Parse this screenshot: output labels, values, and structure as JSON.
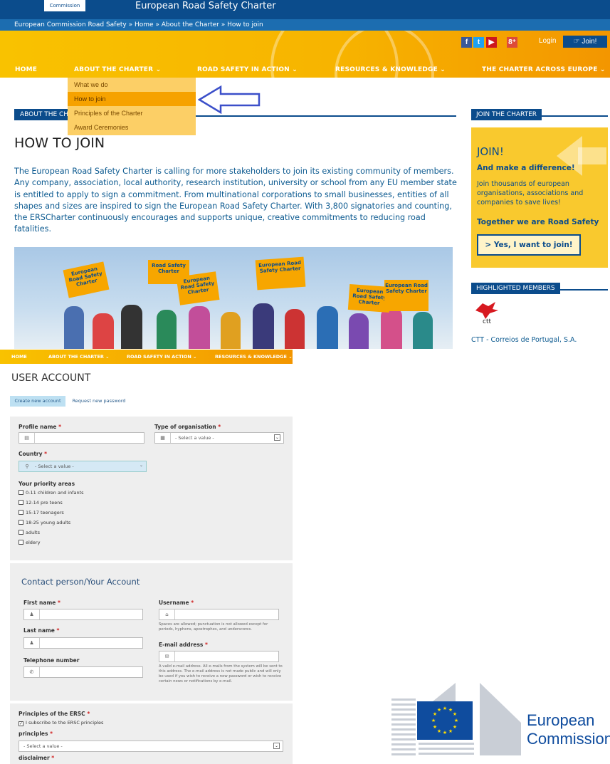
{
  "site": {
    "commission_logo": "Commission",
    "title": "European Road Safety Charter",
    "breadcrumb": "European Commission Road Safety » Home » About the Charter » How to join",
    "login": "Login",
    "join_button": "Join!",
    "social_icons": [
      "facebook-icon",
      "twitter-icon",
      "youtube-icon",
      "googleplus-icon"
    ]
  },
  "nav": {
    "home": "HOME",
    "about": "ABOUT THE CHARTER ⌄",
    "action": "ROAD SAFETY IN ACTION ⌄",
    "resources": "RESOURCES & KNOWLEDGE ⌄",
    "across": "THE CHARTER ACROSS EUROPE ⌄"
  },
  "dropdown": {
    "items": [
      "What we do",
      "How to join",
      "Principles of the Charter",
      "Award Ceremonies"
    ],
    "active_index": 1
  },
  "section_head": "ABOUT THE CHARTER",
  "page_title": "HOW TO JOIN",
  "intro": "The European Road Safety Charter is calling for more stakeholders to join its existing community of members. Any company, association, local authority, research institution, university or school from any EU member state is entitled to apply to sign a commitment. From multinational corporations to small businesses, entities of all shapes and sizes are inspired to sign the European Road Safety Charter. With 3,800 signatories and counting, the ERSCharter continuously encourages and supports unique, creative commitments to reducing road fatalities.",
  "photo_signs": [
    "European Road Safety Charter",
    "Road Safety Charter",
    "European Road Safety Charter",
    "European Road Safety Charter",
    "European Road Safety Charter",
    "European Road Safety Charter"
  ],
  "sidebar": {
    "join_head": "JOIN THE CHARTER",
    "join_title": "JOIN!",
    "join_sub": "And make a difference!",
    "join_text": "Join thousands of european organisations, associations and companies to save lives!",
    "join_together": "Together we are Road Safety",
    "join_yes": "> Yes, I want to join!",
    "highlighted_head": "HIGHLIGHTED MEMBERS",
    "member_logo_text": "ctt",
    "member_name": "CTT - Correios de Portugal, S.A."
  },
  "form": {
    "mini_nav": [
      "HOME",
      "ABOUT THE CHARTER ⌄",
      "ROAD SAFETY IN ACTION ⌄",
      "RESOURCES & KNOWLEDGE ⌄"
    ],
    "title": "USER ACCOUNT",
    "tabs": [
      "Create new account",
      "Request new password"
    ],
    "profile_name": "Profile name",
    "org_type": "Type of organisation",
    "org_type_value": "- Select a value -",
    "country": "Country",
    "country_value": "- Select a value -",
    "priority_areas": "Your priority areas",
    "priorities": [
      "0-11 children and infants",
      "12-14 pre teens",
      "15-17 teenagers",
      "18-25 young adults",
      "adults",
      "eldery"
    ],
    "contact_title": "Contact person/Your Account",
    "first_name": "First name",
    "last_name": "Last name",
    "telephone": "Telephone number",
    "username": "Username",
    "username_help": "Spaces are allowed; punctuation is not allowed except for periods, hyphens, apostrophes, and underscores.",
    "email": "E-mail address",
    "email_help": "A valid e-mail address. All e-mails from the system will be sent to this address. The e-mail address is not made public and will only be used if you wish to receive a new password or wish to receive certain news or notifications by e-mail.",
    "principles_head": "Principles of the ERSC",
    "subscribe": "I subscribe to the ERSC principles",
    "principles": "principles",
    "principles_value": "- Select a value -",
    "disclaimer": "disclaimer",
    "required_mark": "*"
  },
  "eu_logo": {
    "line1": "European",
    "line2": "Commission"
  },
  "colors": {
    "navy": "#0b4c8c",
    "orange": "#f7b400",
    "yellow_box": "#f9c92e",
    "link_blue": "#0c5a90"
  }
}
